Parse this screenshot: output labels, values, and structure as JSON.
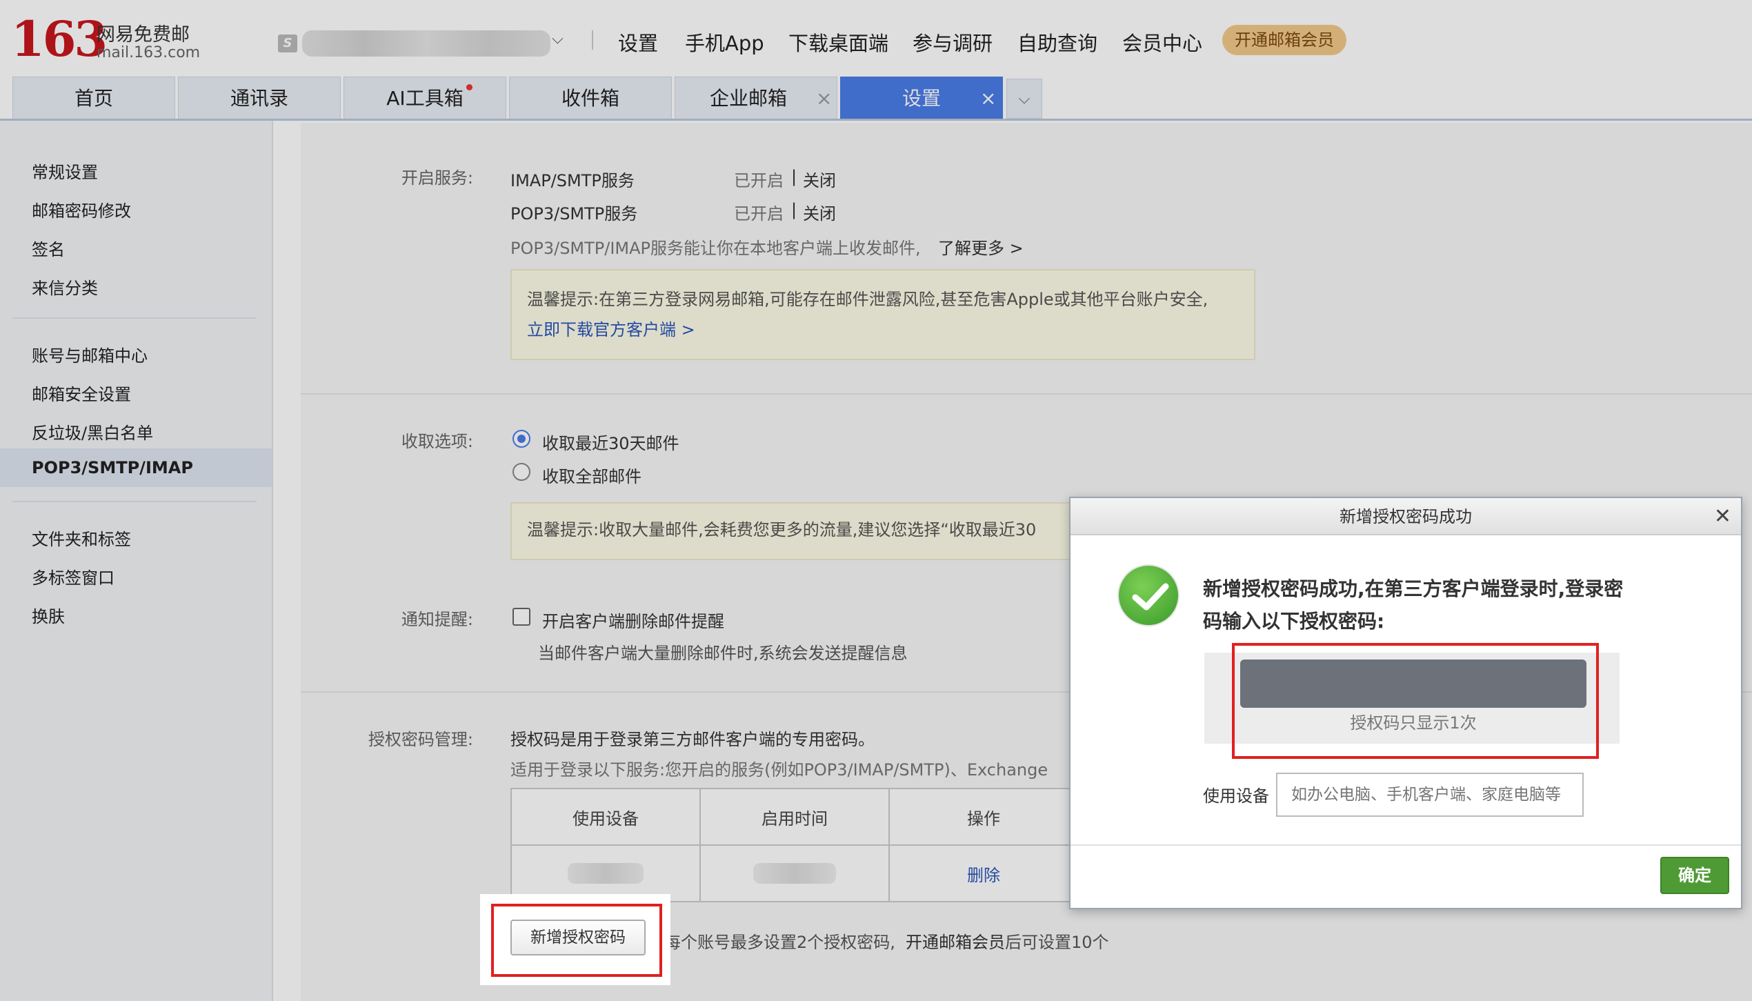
{
  "header": {
    "logo_number": "163",
    "logo_name": "网易免费邮",
    "logo_url": "mail.163.com",
    "nav": [
      "设置",
      "手机App",
      "下载桌面端",
      "参与调研",
      "自助查询",
      "会员中心"
    ],
    "vip_button": "开通邮箱会员"
  },
  "tabs": [
    {
      "label": "首页"
    },
    {
      "label": "通讯录"
    },
    {
      "label": "AI工具箱"
    },
    {
      "label": "收件箱"
    },
    {
      "label": "企业邮箱",
      "close": "×"
    },
    {
      "label": "设置",
      "close": "×",
      "active": true
    }
  ],
  "sidebar": {
    "groups": [
      [
        "常规设置",
        "邮箱密码修改",
        "签名",
        "来信分类"
      ],
      [
        "账号与邮箱中心",
        "邮箱安全设置",
        "反垃圾/黑白名单",
        "POP3/SMTP/IMAP"
      ],
      [
        "文件夹和标签",
        "多标签窗口",
        "换肤"
      ]
    ],
    "active_item": "POP3/SMTP/IMAP"
  },
  "services": {
    "label": "开启服务:",
    "rows": [
      {
        "name": "IMAP/SMTP服务",
        "status": "已开启",
        "sep": "|",
        "action": "关闭"
      },
      {
        "name": "POP3/SMTP服务",
        "status": "已开启",
        "sep": "|",
        "action": "关闭"
      }
    ],
    "desc": "POP3/SMTP/IMAP服务能让你在本地客户端上收发邮件,",
    "learn_more": "了解更多 >",
    "tip_text": "温馨提示:在第三方登录网易邮箱,可能存在邮件泄露风险,甚至危害Apple或其他平台账户安全,",
    "tip_link": "立即下载官方客户端 >"
  },
  "receive": {
    "label": "收取选项:",
    "options": [
      "收取最近30天邮件",
      "收取全部邮件"
    ],
    "selected": "收取最近30天邮件",
    "tip": "温馨提示:收取大量邮件,会耗费您更多的流量,建议您选择“收取最近30"
  },
  "notify": {
    "label": "通知提醒:",
    "checkbox_label": "开启客户端删除邮件提醒",
    "checked": false,
    "desc": "当邮件客户端大量删除邮件时,系统会发送提醒信息"
  },
  "auth": {
    "label": "授权密码管理:",
    "desc1": "授权码是用于登录第三方邮件客户端的专用密码。",
    "desc2": "适用于登录以下服务:您开启的服务(例如POP3/IMAP/SMTP)、Exchange",
    "table_headers": [
      "使用设备",
      "启用时间",
      "操作"
    ],
    "row_action": "删除",
    "new_button": "新增授权密码",
    "limit_text": "每个账号最多设置2个授权密码,",
    "limit_link": "开通邮箱会员",
    "limit_suffix": "后可设置10个"
  },
  "dialog": {
    "title": "新增授权密码成功",
    "close": "✕",
    "message": "新增授权密码成功,在第三方客户端登录时,登录密码输入以下授权密码:",
    "code_note": "授权码只显示1次",
    "device_label": "使用设备",
    "device_placeholder": "如办公电脑、手机客户端、家庭电脑等",
    "ok_button": "确定"
  },
  "colors": {
    "brand_red": "#c8161d",
    "tab_active": "#4a7de8",
    "link_blue": "#2a55b9",
    "ok_green": "#4e9b35",
    "highlight_red": "#e02020"
  }
}
